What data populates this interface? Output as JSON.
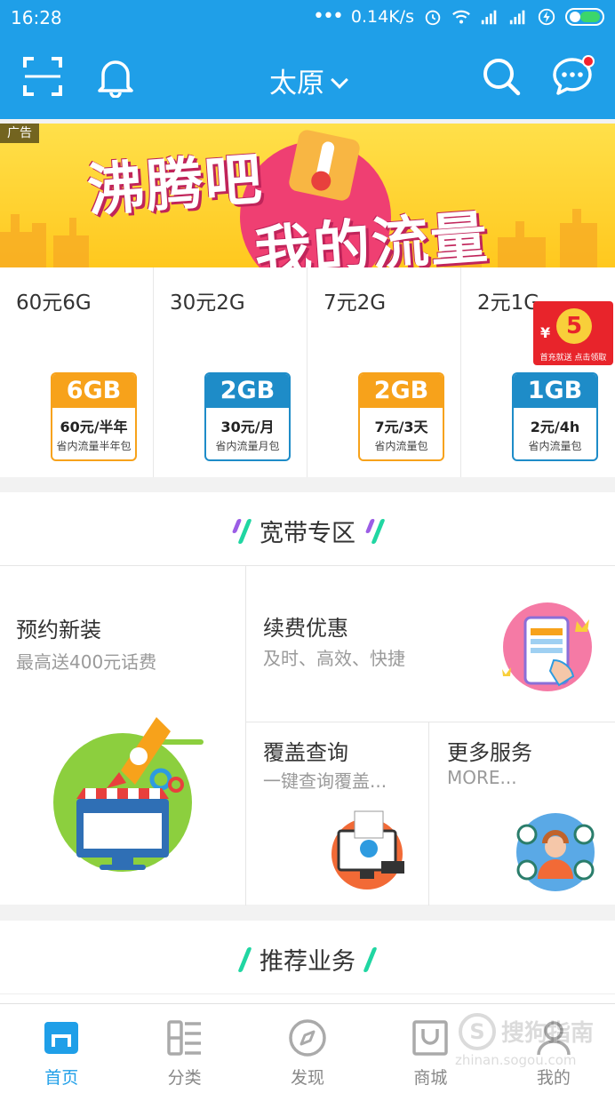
{
  "status_bar": {
    "time": "16:28",
    "network_speed": "0.14K/s",
    "icons": [
      "signal-dots-icon",
      "alarm-icon",
      "wifi-icon",
      "cell-signal-icon",
      "cell-signal-icon",
      "charging-icon",
      "battery-icon"
    ]
  },
  "header": {
    "city": "太原",
    "icons": [
      "scan-icon",
      "bell-icon",
      "search-icon",
      "message-icon"
    ],
    "accent": "#1f9fe8",
    "badge_color": "#f5222d"
  },
  "banner": {
    "ad_label": "广告",
    "line1": "沸腾吧",
    "line2": "我的流量"
  },
  "packages": [
    {
      "name": "60元6G",
      "size": "6GB",
      "price": "60元/半年",
      "desc": "省内流量半年包",
      "color": "orange"
    },
    {
      "name": "30元2G",
      "size": "2GB",
      "price": "30元/月",
      "desc": "省内流量月包",
      "color": "blue"
    },
    {
      "name": "7元2G",
      "size": "2GB",
      "price": "7元/3天",
      "desc": "省内流量包",
      "color": "orange"
    },
    {
      "name": "2元1G",
      "size": "1GB",
      "price": "2元/4h",
      "desc": "省内流量包",
      "color": "blue"
    }
  ],
  "red_packet": {
    "amount": "5",
    "currency": "¥",
    "text": "首充就送 点击领取"
  },
  "broadband": {
    "title": "宽带专区",
    "tiles": [
      {
        "title": "预约新装",
        "subtitle": "最高送400元话费"
      },
      {
        "title": "续费优惠",
        "subtitle": "及时、高效、快捷"
      },
      {
        "title": "覆盖查询",
        "subtitle": "一键查询覆盖..."
      },
      {
        "title": "更多服务",
        "subtitle": "MORE..."
      }
    ]
  },
  "recommend": {
    "title": "推荐业务"
  },
  "tabbar": {
    "tabs": [
      {
        "label": "首页",
        "icon": "home-icon",
        "active": true
      },
      {
        "label": "分类",
        "icon": "category-icon",
        "active": false
      },
      {
        "label": "发现",
        "icon": "compass-icon",
        "active": false
      },
      {
        "label": "商城",
        "icon": "shop-icon",
        "active": false
      },
      {
        "label": "我的",
        "icon": "user-icon",
        "active": false
      }
    ]
  },
  "watermark": {
    "brand": "搜狗指南",
    "url": "zhinan.sogou.com"
  }
}
